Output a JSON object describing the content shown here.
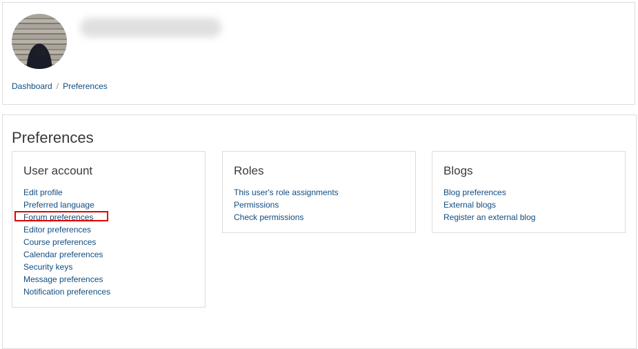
{
  "breadcrumb": [
    "Dashboard",
    "Preferences"
  ],
  "page_title": "Preferences",
  "panels": [
    {
      "title": "User account",
      "links": [
        "Edit profile",
        "Preferred language",
        "Forum preferences",
        "Editor preferences",
        "Course preferences",
        "Calendar preferences",
        "Security keys",
        "Message preferences",
        "Notification preferences"
      ]
    },
    {
      "title": "Roles",
      "links": [
        "This user's role assignments",
        "Permissions",
        "Check permissions"
      ]
    },
    {
      "title": "Blogs",
      "links": [
        "Blog preferences",
        "External blogs",
        "Register an external blog"
      ]
    }
  ],
  "colors": {
    "link": "#0f4c81",
    "highlight": "#e30000",
    "border": "#dcdcdc"
  }
}
